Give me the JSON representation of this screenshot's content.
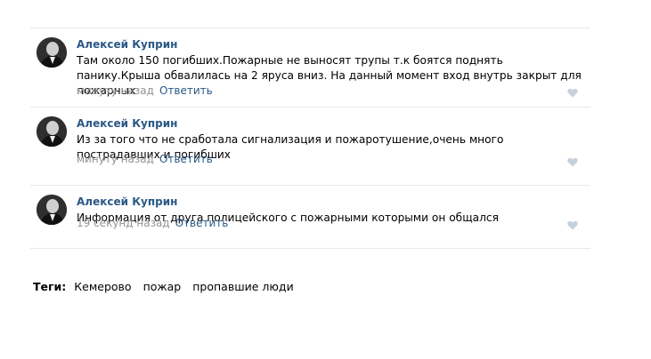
{
  "comments": [
    {
      "author": "Алексей Куприн",
      "text": "Там около 150 погибших.Пожарные не выносят трупы т.к боятся поднять панику.Крыша обвалилась на 2 яруса вниз. На данный момент вход внутрь закрыт для пожарных",
      "time": "минуту назад",
      "reply": "Ответить"
    },
    {
      "author": "Алексей Куприн",
      "text": "Из за того что не сработала сигнализация и пожаротушение,очень много пострадавших и погибших",
      "time": "минуту назад",
      "reply": "Ответить"
    },
    {
      "author": "Алексей Куприн",
      "text": "Информация от друга полицейского с пожарными которыми он общался",
      "time": "19 секунд назад",
      "reply": "Ответить"
    }
  ],
  "tags": {
    "label": "Теги:",
    "items": [
      "Кемерово",
      "пожар",
      "пропавшие люди"
    ]
  },
  "colors": {
    "link": "#2a5885",
    "meta": "#939393",
    "divider": "#e7e8ec",
    "like_icon": "#c5d0db"
  },
  "icons": {
    "like": "heart-icon",
    "avatar": "user-photo"
  }
}
